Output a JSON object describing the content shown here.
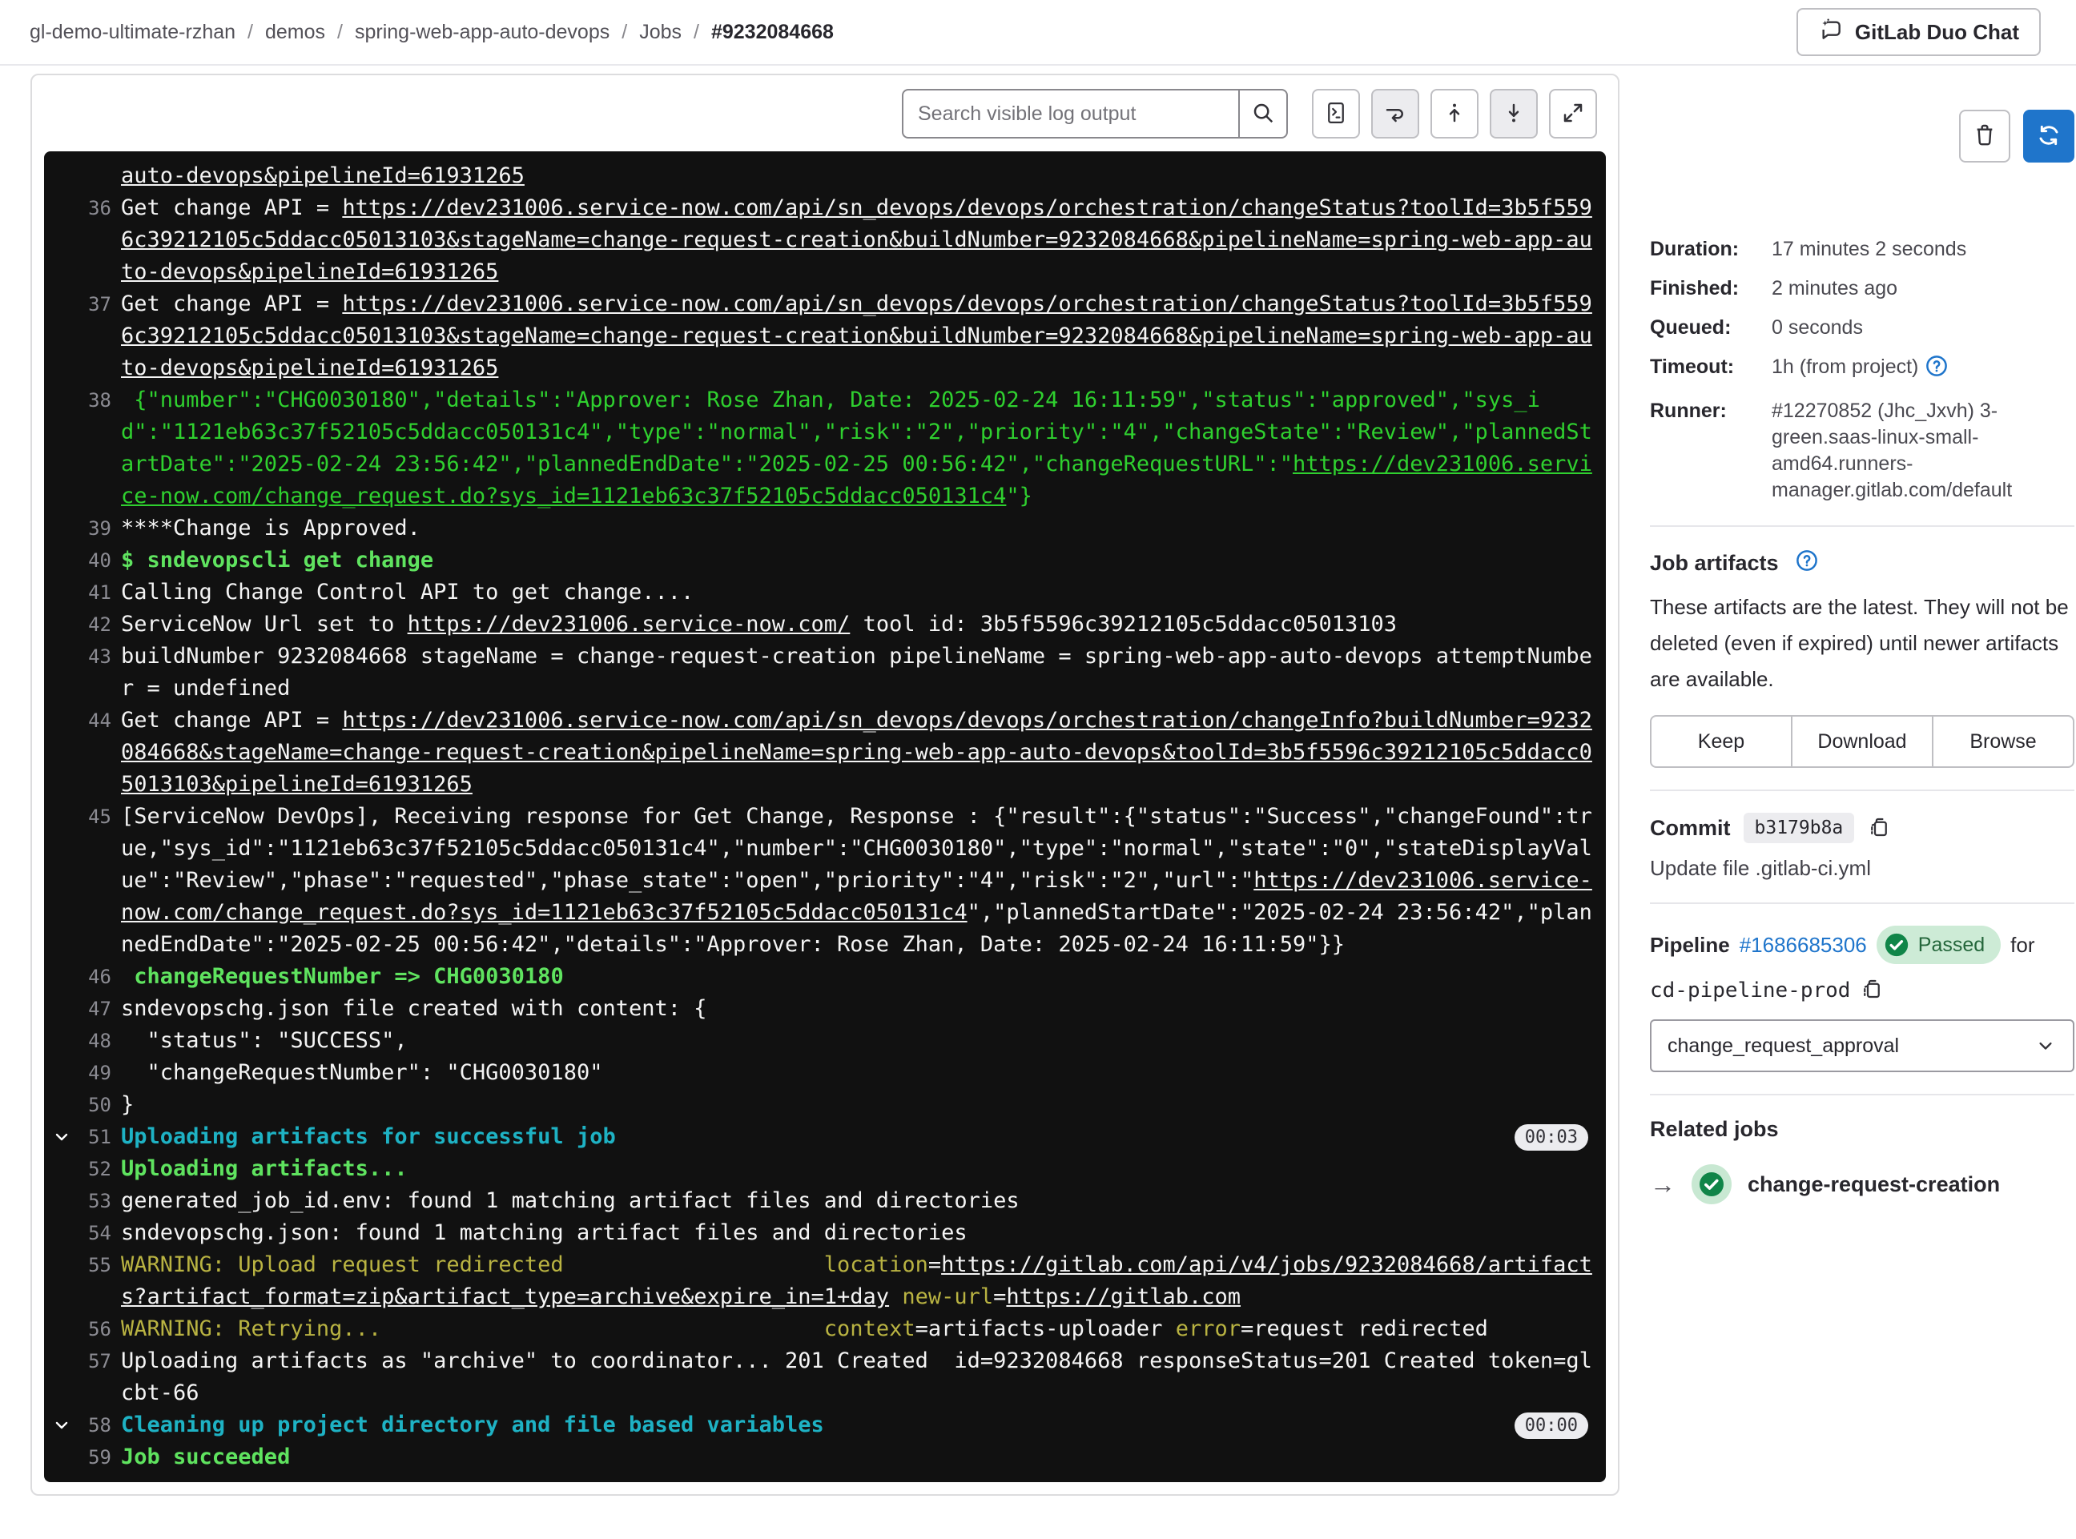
{
  "breadcrumb": {
    "items": [
      "gl-demo-ultimate-rzhan",
      "demos",
      "spring-web-app-auto-devops",
      "Jobs"
    ],
    "current": "#9232084668"
  },
  "header": {
    "duo_chat_label": "GitLab Duo Chat"
  },
  "log_toolbar": {
    "search_placeholder": "Search visible log output"
  },
  "log": {
    "lines": [
      {
        "num": "",
        "segments": [
          [
            "wl",
            "auto-devops&pipelineId=61931265"
          ]
        ]
      },
      {
        "num": "36",
        "segments": [
          [
            "w",
            "Get change API = "
          ],
          [
            "wl",
            "https://dev231006.service-now.com/api/sn_devops/devops/orchestration/changeStatus?toolId=3b5f5596c39212105c5ddacc05013103&stageName=change-request-creation&buildNumber=9232084668&pipelineName=spring-web-app-auto-devops&pipelineId=61931265"
          ]
        ]
      },
      {
        "num": "37",
        "segments": [
          [
            "w",
            "Get change API = "
          ],
          [
            "wl",
            "https://dev231006.service-now.com/api/sn_devops/devops/orchestration/changeStatus?toolId=3b5f5596c39212105c5ddacc05013103&stageName=change-request-creation&buildNumber=9232084668&pipelineName=spring-web-app-auto-devops&pipelineId=61931265"
          ]
        ]
      },
      {
        "num": "38",
        "segments": [
          [
            "g",
            " {\"number\":\"CHG0030180\",\"details\":\"Approver: Rose Zhan, Date: 2025-02-24 16:11:59\",\"status\":\"approved\",\"sys_id\":\"1121eb63c37f52105c5ddacc050131c4\",\"type\":\"normal\",\"risk\":\"2\",\"priority\":\"4\",\"changeState\":\"Review\",\"plannedStartDate\":\"2025-02-24 23:56:42\",\"plannedEndDate\":\"2025-02-25 00:56:42\",\"changeRequestURL\":\""
          ],
          [
            "gl",
            "https://dev231006.service-now.com/change_request.do?sys_id=1121eb63c37f52105c5ddacc050131c4"
          ],
          [
            "g",
            "\"}"
          ]
        ]
      },
      {
        "num": "39",
        "segments": [
          [
            "w",
            "****Change is Approved."
          ]
        ]
      },
      {
        "num": "40",
        "segments": [
          [
            "gb",
            "$ sndevopscli get change"
          ]
        ]
      },
      {
        "num": "41",
        "segments": [
          [
            "w",
            "Calling Change Control API to get change...."
          ]
        ]
      },
      {
        "num": "42",
        "segments": [
          [
            "w",
            "ServiceNow Url set to "
          ],
          [
            "wl",
            "https://dev231006.service-now.com/"
          ],
          [
            "w",
            " tool id: 3b5f5596c39212105c5ddacc05013103"
          ]
        ]
      },
      {
        "num": "43",
        "segments": [
          [
            "w",
            "buildNumber 9232084668 stageName = change-request-creation pipelineName = spring-web-app-auto-devops attemptNumber = undefined"
          ]
        ]
      },
      {
        "num": "44",
        "segments": [
          [
            "w",
            "Get change API = "
          ],
          [
            "wl",
            "https://dev231006.service-now.com/api/sn_devops/devops/orchestration/changeInfo?buildNumber=9232084668&stageName=change-request-creation&pipelineName=spring-web-app-auto-devops&toolId=3b5f5596c39212105c5ddacc05013103&pipelineId=61931265"
          ]
        ]
      },
      {
        "num": "45",
        "segments": [
          [
            "w",
            "[ServiceNow DevOps], Receiving response for Get Change, Response : {\"result\":{\"status\":\"Success\",\"changeFound\":true,\"sys_id\":\"1121eb63c37f52105c5ddacc050131c4\",\"number\":\"CHG0030180\",\"type\":\"normal\",\"state\":\"0\",\"stateDisplayValue\":\"Review\",\"phase\":\"requested\",\"phase_state\":\"open\",\"priority\":\"4\",\"risk\":\"2\",\"url\":\""
          ],
          [
            "wl",
            "https://dev231006.service-now.com/change_request.do?sys_id=1121eb63c37f52105c5ddacc050131c4"
          ],
          [
            "w",
            "\",\"plannedStartDate\":\"2025-02-24 23:56:42\",\"plannedEndDate\":\"2025-02-25 00:56:42\",\"details\":\"Approver: Rose Zhan, Date: 2025-02-24 16:11:59\"}}"
          ]
        ]
      },
      {
        "num": "46",
        "segments": [
          [
            "gb",
            " changeRequestNumber => CHG0030180"
          ]
        ]
      },
      {
        "num": "47",
        "segments": [
          [
            "w",
            "sndevopschg.json file created with content: {"
          ]
        ]
      },
      {
        "num": "48",
        "segments": [
          [
            "w",
            "  \"status\": \"SUCCESS\","
          ]
        ]
      },
      {
        "num": "49",
        "segments": [
          [
            "w",
            "  \"changeRequestNumber\": \"CHG0030180\""
          ]
        ]
      },
      {
        "num": "50",
        "segments": [
          [
            "w",
            "}"
          ]
        ]
      },
      {
        "num": "51",
        "chevron": true,
        "badge": "00:03",
        "segments": [
          [
            "c",
            "Uploading artifacts for successful job"
          ]
        ]
      },
      {
        "num": "52",
        "segments": [
          [
            "gb",
            "Uploading artifacts..."
          ]
        ]
      },
      {
        "num": "53",
        "segments": [
          [
            "w",
            "generated_job_id.env: found 1 matching artifact files and directories"
          ]
        ]
      },
      {
        "num": "54",
        "segments": [
          [
            "w",
            "sndevopschg.json: found 1 matching artifact files and directories"
          ]
        ]
      },
      {
        "num": "55",
        "segments": [
          [
            "y",
            "WARNING: Upload request redirected"
          ],
          [
            "w",
            "                    "
          ],
          [
            "y",
            "location"
          ],
          [
            "w",
            "="
          ],
          [
            "wl",
            "https://gitlab.com/api/v4/jobs/9232084668/artifacts?artifact_format=zip&artifact_type=archive&expire_in=1+day"
          ],
          [
            "w",
            " "
          ],
          [
            "y",
            "new-url"
          ],
          [
            "w",
            "="
          ],
          [
            "wl",
            "https://gitlab.com"
          ]
        ]
      },
      {
        "num": "56",
        "segments": [
          [
            "y",
            "WARNING: Retrying..."
          ],
          [
            "w",
            "                                  "
          ],
          [
            "y",
            "context"
          ],
          [
            "w",
            "=artifacts-uploader "
          ],
          [
            "y",
            "error"
          ],
          [
            "w",
            "=request redirected"
          ]
        ]
      },
      {
        "num": "57",
        "segments": [
          [
            "w",
            "Uploading artifacts as \"archive\" to coordinator... 201 Created  id=9232084668 responseStatus=201 Created token=glcbt-66"
          ]
        ]
      },
      {
        "num": "58",
        "chevron": true,
        "badge": "00:00",
        "segments": [
          [
            "c",
            "Cleaning up project directory and file based variables"
          ]
        ]
      },
      {
        "num": "59",
        "segments": [
          [
            "gb",
            "Job succeeded"
          ]
        ]
      }
    ]
  },
  "sidebar": {
    "details": [
      {
        "label": "Duration:",
        "value": "17 minutes 2 seconds"
      },
      {
        "label": "Finished:",
        "value": "2 minutes ago"
      },
      {
        "label": "Queued:",
        "value": "0 seconds"
      },
      {
        "label": "Timeout:",
        "value": "1h (from project)",
        "help": true
      },
      {
        "label": "Runner:",
        "value": "#12270852 (Jhc_Jxvh) 3-green.saas-linux-small-amd64.runners-manager.gitlab.com/default"
      }
    ],
    "artifacts": {
      "title": "Job artifacts",
      "description": "These artifacts are the latest. They will not be deleted (even if expired) until newer artifacts are available.",
      "buttons": [
        "Keep",
        "Download",
        "Browse"
      ]
    },
    "commit": {
      "label": "Commit",
      "sha": "b3179b8a",
      "message": "Update file .gitlab-ci.yml"
    },
    "pipeline": {
      "label": "Pipeline",
      "id": "#1686685306",
      "status": "Passed",
      "for_text": "for",
      "ref": "cd-pipeline-prod",
      "selected_stage": "change_request_approval"
    },
    "related_jobs": {
      "title": "Related jobs",
      "jobs": [
        {
          "name": "change-request-creation",
          "status": "passed"
        }
      ]
    },
    "colors": {
      "accent_blue": "#1f75cb",
      "success_green": "#108548",
      "badge_bg": "#cdebd6",
      "log_bg": "#111111"
    }
  }
}
